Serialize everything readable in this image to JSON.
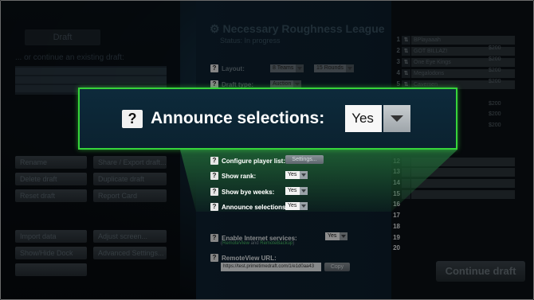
{
  "league": {
    "title": "Necessary Roughness League",
    "status": "Status: In progress"
  },
  "left_panel": {
    "draft_button": "Draft",
    "load_label": "... or continue an existing draft:",
    "buttons": {
      "b1": "Rename",
      "b2": "Share / Export draft...",
      "b3": "Delete draft",
      "b4": "Duplicate draft",
      "b5": "Reset draft",
      "b6": "Report Card",
      "b7": "Import data",
      "b8": "Adjust screen...",
      "b9": "Show/Hide Dock",
      "b10": "Advanced Settings..."
    }
  },
  "settings": {
    "layout_label": "Layout:",
    "layout_teams": "8 Teams",
    "layout_rounds": "15 Rounds",
    "draft_type_label": "Draft type:",
    "draft_type_value": "Auction",
    "configure_label": "Configure player list:",
    "configure_button": "Settings...",
    "show_rank_label": "Show rank:",
    "show_rank_value": "Yes",
    "show_bye_label": "Show bye weeks:",
    "show_bye_value": "Yes",
    "announce_label": "Announce selections:",
    "announce_value": "Yes",
    "internet_label": "Enable Internet services:",
    "internet_value": "Yes",
    "internet_sub_pre": "(",
    "internet_sub_remote": "RemoteView",
    "internet_sub_and": " and ",
    "internet_sub_backup": "RemoteBackup",
    "internet_sub_post": ")",
    "remote_label": "RemoteView URL:",
    "remote_url": "https://test.primetimedraft.com/1/e1d0aa43",
    "copy_button": "Copy"
  },
  "callout": {
    "icon": "?",
    "label": "Announce selections:",
    "value": "Yes"
  },
  "roster": {
    "numbers_dim": [
      "1",
      "2",
      "3",
      "4",
      "5"
    ],
    "numbers_lit": [
      "12",
      "13",
      "14",
      "15",
      "16",
      "17",
      "18",
      "19",
      "20"
    ],
    "teams": [
      "BPlayaaah",
      "GOT BILLAZ!",
      "One Eye Kings",
      "Megalodons",
      "Cavemen"
    ],
    "amounts": [
      "$200",
      "$200",
      "$200",
      "$200",
      "$200",
      "$200",
      "$200"
    ]
  },
  "continue_button": "Continue draft",
  "colors": {
    "highlight_border": "#36d43a",
    "link_green": "#4ec46a"
  }
}
